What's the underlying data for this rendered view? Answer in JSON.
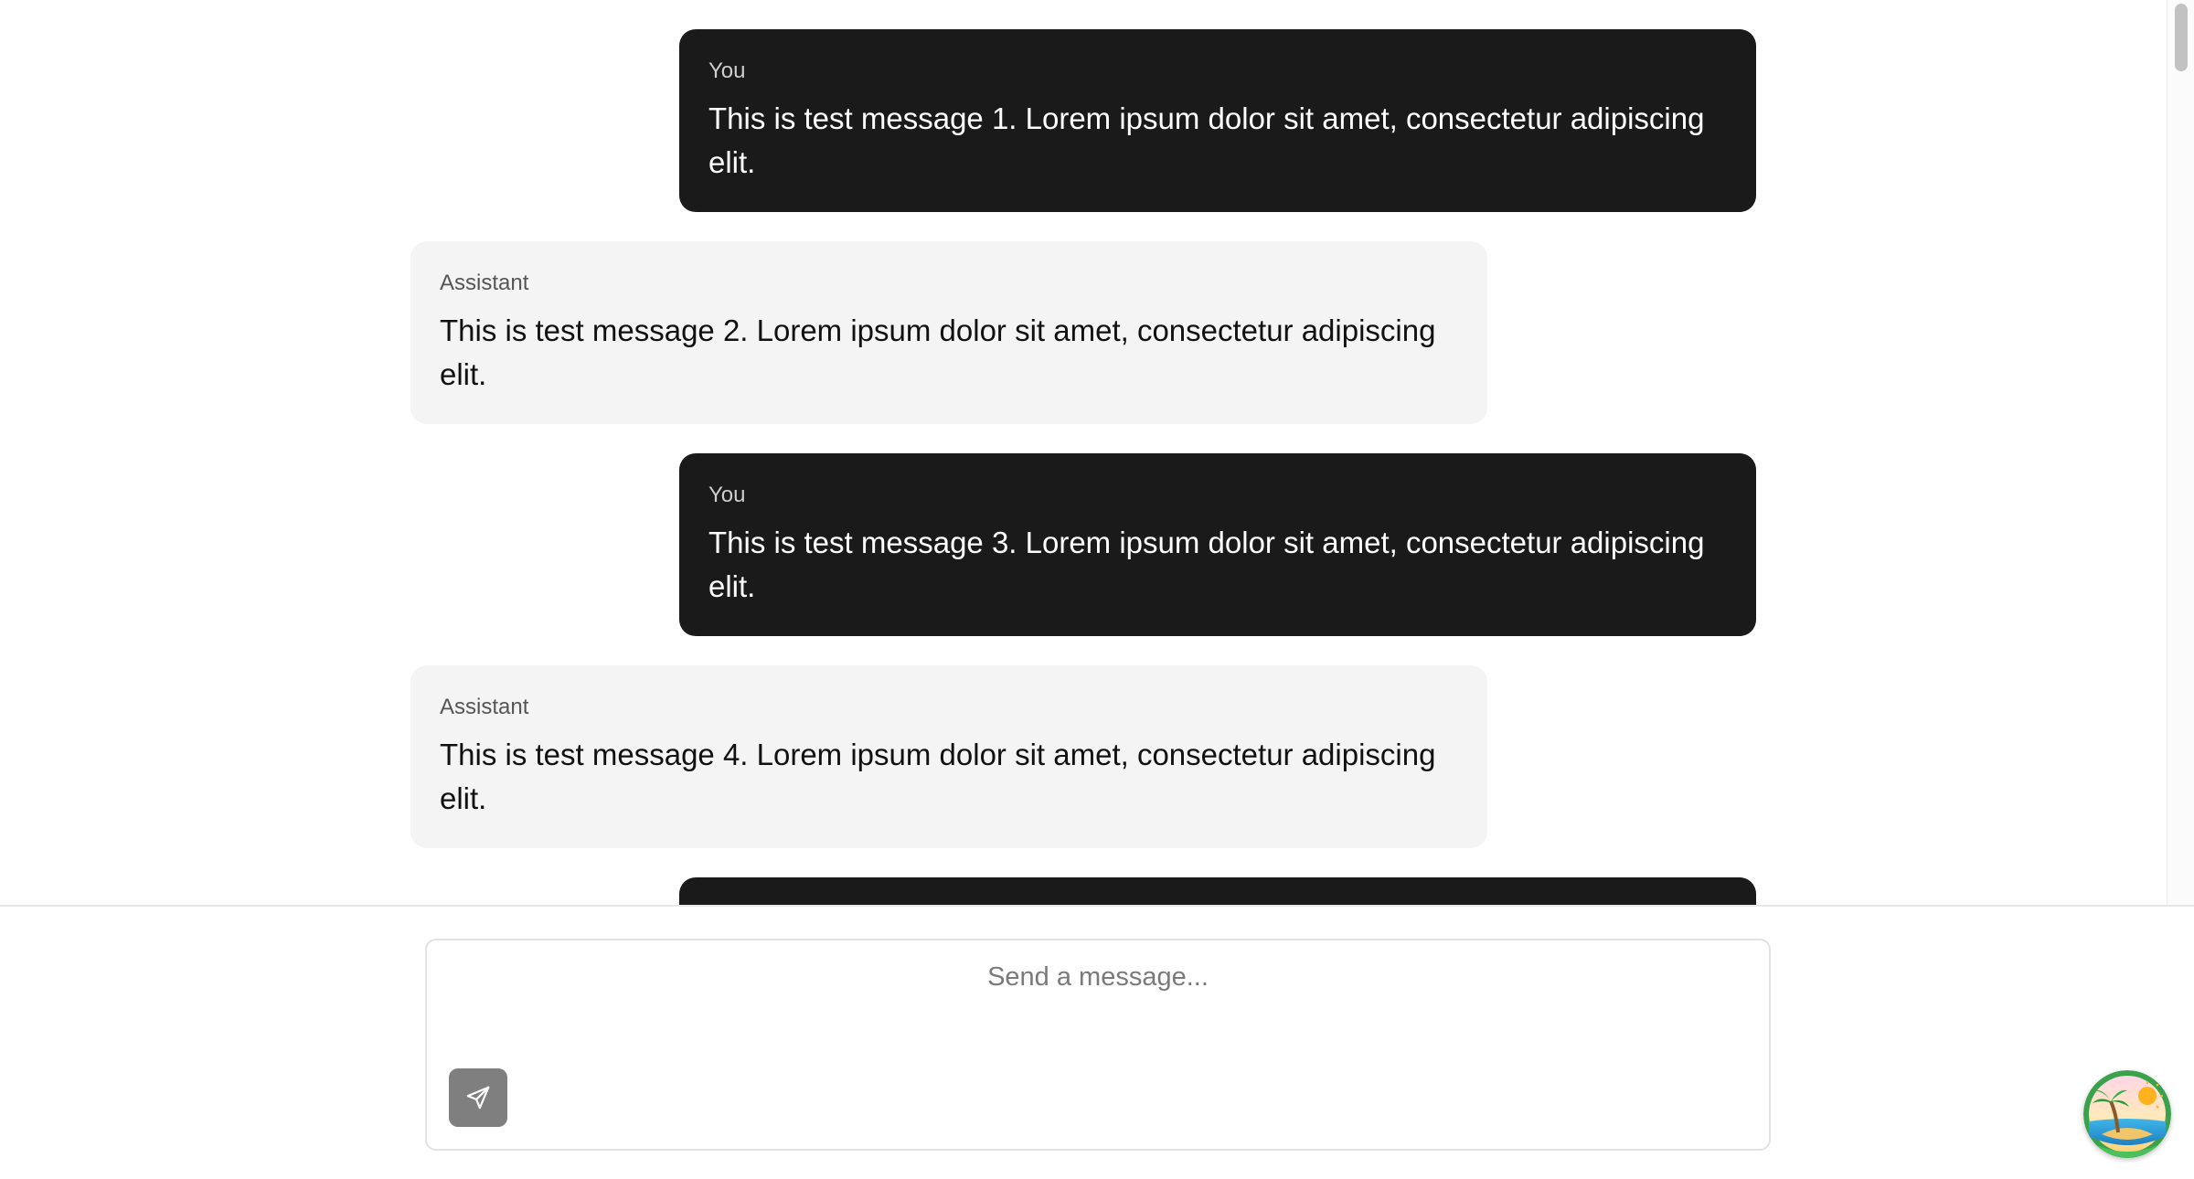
{
  "chat": {
    "messages": [
      {
        "role": "You",
        "text": "This is test message 1. Lorem ipsum dolor sit amet, consectetur adipiscing elit."
      },
      {
        "role": "Assistant",
        "text": "This is test message 2. Lorem ipsum dolor sit amet, consectetur adipiscing elit."
      },
      {
        "role": "You",
        "text": "This is test message 3. Lorem ipsum dolor sit amet, consectetur adipiscing elit."
      },
      {
        "role": "Assistant",
        "text": "This is test message 4. Lorem ipsum dolor sit amet, consectetur adipiscing elit."
      }
    ]
  },
  "composer": {
    "placeholder": "Send a message...",
    "send_icon": "paper-plane-icon"
  },
  "widget": {
    "icon": "tropical-island-icon"
  },
  "colors": {
    "user_bubble": "#1a1a1a",
    "assistant_bubble": "#f4f4f4",
    "send_button": "#7f7f7f"
  }
}
